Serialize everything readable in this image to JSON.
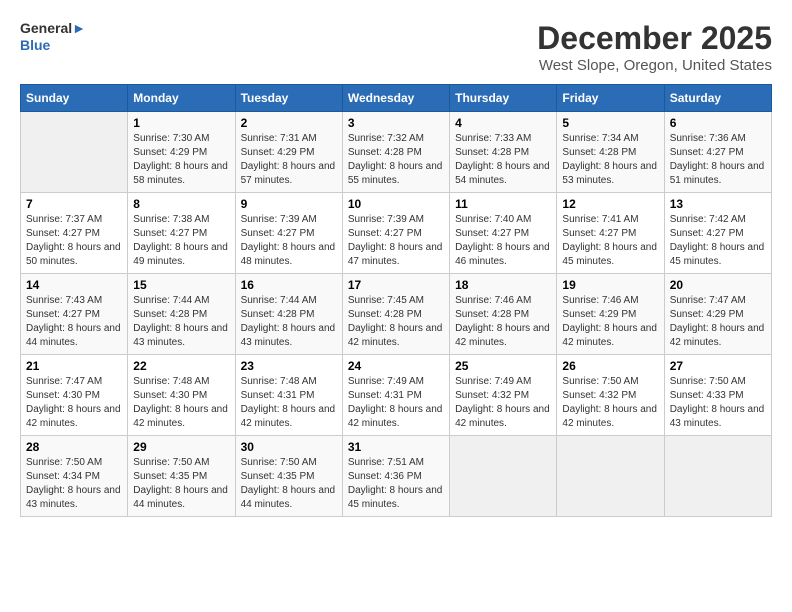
{
  "header": {
    "logo_line1": "General",
    "logo_line2": "Blue",
    "title": "December 2025",
    "subtitle": "West Slope, Oregon, United States"
  },
  "calendar": {
    "days_of_week": [
      "Sunday",
      "Monday",
      "Tuesday",
      "Wednesday",
      "Thursday",
      "Friday",
      "Saturday"
    ],
    "weeks": [
      [
        {
          "num": "",
          "info": ""
        },
        {
          "num": "1",
          "info": "Sunrise: 7:30 AM\nSunset: 4:29 PM\nDaylight: 8 hours\nand 58 minutes."
        },
        {
          "num": "2",
          "info": "Sunrise: 7:31 AM\nSunset: 4:29 PM\nDaylight: 8 hours\nand 57 minutes."
        },
        {
          "num": "3",
          "info": "Sunrise: 7:32 AM\nSunset: 4:28 PM\nDaylight: 8 hours\nand 55 minutes."
        },
        {
          "num": "4",
          "info": "Sunrise: 7:33 AM\nSunset: 4:28 PM\nDaylight: 8 hours\nand 54 minutes."
        },
        {
          "num": "5",
          "info": "Sunrise: 7:34 AM\nSunset: 4:28 PM\nDaylight: 8 hours\nand 53 minutes."
        },
        {
          "num": "6",
          "info": "Sunrise: 7:36 AM\nSunset: 4:27 PM\nDaylight: 8 hours\nand 51 minutes."
        }
      ],
      [
        {
          "num": "7",
          "info": "Sunrise: 7:37 AM\nSunset: 4:27 PM\nDaylight: 8 hours\nand 50 minutes."
        },
        {
          "num": "8",
          "info": "Sunrise: 7:38 AM\nSunset: 4:27 PM\nDaylight: 8 hours\nand 49 minutes."
        },
        {
          "num": "9",
          "info": "Sunrise: 7:39 AM\nSunset: 4:27 PM\nDaylight: 8 hours\nand 48 minutes."
        },
        {
          "num": "10",
          "info": "Sunrise: 7:39 AM\nSunset: 4:27 PM\nDaylight: 8 hours\nand 47 minutes."
        },
        {
          "num": "11",
          "info": "Sunrise: 7:40 AM\nSunset: 4:27 PM\nDaylight: 8 hours\nand 46 minutes."
        },
        {
          "num": "12",
          "info": "Sunrise: 7:41 AM\nSunset: 4:27 PM\nDaylight: 8 hours\nand 45 minutes."
        },
        {
          "num": "13",
          "info": "Sunrise: 7:42 AM\nSunset: 4:27 PM\nDaylight: 8 hours\nand 45 minutes."
        }
      ],
      [
        {
          "num": "14",
          "info": "Sunrise: 7:43 AM\nSunset: 4:27 PM\nDaylight: 8 hours\nand 44 minutes."
        },
        {
          "num": "15",
          "info": "Sunrise: 7:44 AM\nSunset: 4:28 PM\nDaylight: 8 hours\nand 43 minutes."
        },
        {
          "num": "16",
          "info": "Sunrise: 7:44 AM\nSunset: 4:28 PM\nDaylight: 8 hours\nand 43 minutes."
        },
        {
          "num": "17",
          "info": "Sunrise: 7:45 AM\nSunset: 4:28 PM\nDaylight: 8 hours\nand 42 minutes."
        },
        {
          "num": "18",
          "info": "Sunrise: 7:46 AM\nSunset: 4:28 PM\nDaylight: 8 hours\nand 42 minutes."
        },
        {
          "num": "19",
          "info": "Sunrise: 7:46 AM\nSunset: 4:29 PM\nDaylight: 8 hours\nand 42 minutes."
        },
        {
          "num": "20",
          "info": "Sunrise: 7:47 AM\nSunset: 4:29 PM\nDaylight: 8 hours\nand 42 minutes."
        }
      ],
      [
        {
          "num": "21",
          "info": "Sunrise: 7:47 AM\nSunset: 4:30 PM\nDaylight: 8 hours\nand 42 minutes."
        },
        {
          "num": "22",
          "info": "Sunrise: 7:48 AM\nSunset: 4:30 PM\nDaylight: 8 hours\nand 42 minutes."
        },
        {
          "num": "23",
          "info": "Sunrise: 7:48 AM\nSunset: 4:31 PM\nDaylight: 8 hours\nand 42 minutes."
        },
        {
          "num": "24",
          "info": "Sunrise: 7:49 AM\nSunset: 4:31 PM\nDaylight: 8 hours\nand 42 minutes."
        },
        {
          "num": "25",
          "info": "Sunrise: 7:49 AM\nSunset: 4:32 PM\nDaylight: 8 hours\nand 42 minutes."
        },
        {
          "num": "26",
          "info": "Sunrise: 7:50 AM\nSunset: 4:32 PM\nDaylight: 8 hours\nand 42 minutes."
        },
        {
          "num": "27",
          "info": "Sunrise: 7:50 AM\nSunset: 4:33 PM\nDaylight: 8 hours\nand 43 minutes."
        }
      ],
      [
        {
          "num": "28",
          "info": "Sunrise: 7:50 AM\nSunset: 4:34 PM\nDaylight: 8 hours\nand 43 minutes."
        },
        {
          "num": "29",
          "info": "Sunrise: 7:50 AM\nSunset: 4:35 PM\nDaylight: 8 hours\nand 44 minutes."
        },
        {
          "num": "30",
          "info": "Sunrise: 7:50 AM\nSunset: 4:35 PM\nDaylight: 8 hours\nand 44 minutes."
        },
        {
          "num": "31",
          "info": "Sunrise: 7:51 AM\nSunset: 4:36 PM\nDaylight: 8 hours\nand 45 minutes."
        },
        {
          "num": "",
          "info": ""
        },
        {
          "num": "",
          "info": ""
        },
        {
          "num": "",
          "info": ""
        }
      ]
    ]
  }
}
